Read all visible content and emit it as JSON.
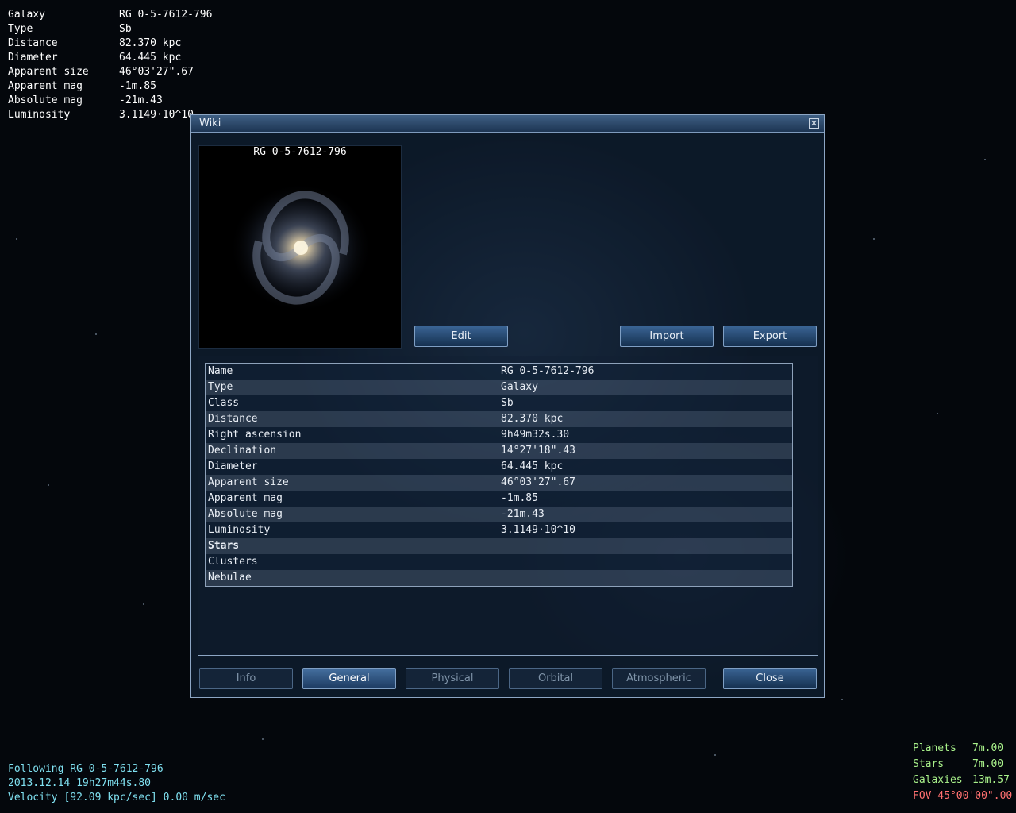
{
  "hud_top_left": [
    {
      "label": "Galaxy",
      "value": "RG 0-5-7612-796"
    },
    {
      "label": "Type",
      "value": "Sb"
    },
    {
      "label": "Distance",
      "value": "82.370 kpc"
    },
    {
      "label": "Diameter",
      "value": "64.445 kpc"
    },
    {
      "label": "Apparent size",
      "value": "46°03'27\".67"
    },
    {
      "label": "Apparent mag",
      "value": "-1m.85"
    },
    {
      "label": "Absolute mag",
      "value": "-21m.43"
    },
    {
      "label": "Luminosity",
      "value": "3.1149·10^10"
    }
  ],
  "window": {
    "title": "Wiki",
    "close_icon": "close-x-icon",
    "preview_title": "RG 0-5-7612-796",
    "buttons": {
      "edit": "Edit",
      "import": "Import",
      "export": "Export"
    },
    "properties": [
      {
        "name": "Name",
        "value": "RG 0-5-7612-796"
      },
      {
        "name": "Type",
        "value": "Galaxy"
      },
      {
        "name": "Class",
        "value": "Sb"
      },
      {
        "name": "Distance",
        "value": "82.370 kpc"
      },
      {
        "name": "Right ascension",
        "value": "9h49m32s.30"
      },
      {
        "name": "Declination",
        "value": "14°27'18\".43"
      },
      {
        "name": "Diameter",
        "value": "64.445 kpc"
      },
      {
        "name": "Apparent size",
        "value": "46°03'27\".67"
      },
      {
        "name": "Apparent mag",
        "value": "-1m.85"
      },
      {
        "name": "Absolute mag",
        "value": "-21m.43"
      },
      {
        "name": "Luminosity",
        "value": "3.1149·10^10"
      },
      {
        "name": "Stars",
        "value": ""
      },
      {
        "name": "Clusters",
        "value": ""
      },
      {
        "name": "Nebulae",
        "value": ""
      }
    ],
    "tabs": {
      "info": "Info",
      "general": "General",
      "physical": "Physical",
      "orbital": "Orbital",
      "atmospheric": "Atmospheric",
      "close": "Close"
    }
  },
  "hud_bottom_left": {
    "following": "Following RG 0-5-7612-796",
    "datetime": "2013.12.14 19h27m44s.80",
    "velocity": "Velocity [92.09 kpc/sec] 0.00 m/sec"
  },
  "hud_bottom_right": {
    "planets_label": "Planets",
    "planets_value": "7m.00",
    "stars_label": "Stars",
    "stars_value": "7m.00",
    "galaxies_label": "Galaxies",
    "galaxies_value": "13m.57",
    "fov": "FOV 45°00'00\".00"
  },
  "colors": {
    "hud_cyan": "#7fe0f0",
    "hud_green": "#a8f08a",
    "hud_red": "#ff7070",
    "button_blue": "#2a4f7a"
  }
}
